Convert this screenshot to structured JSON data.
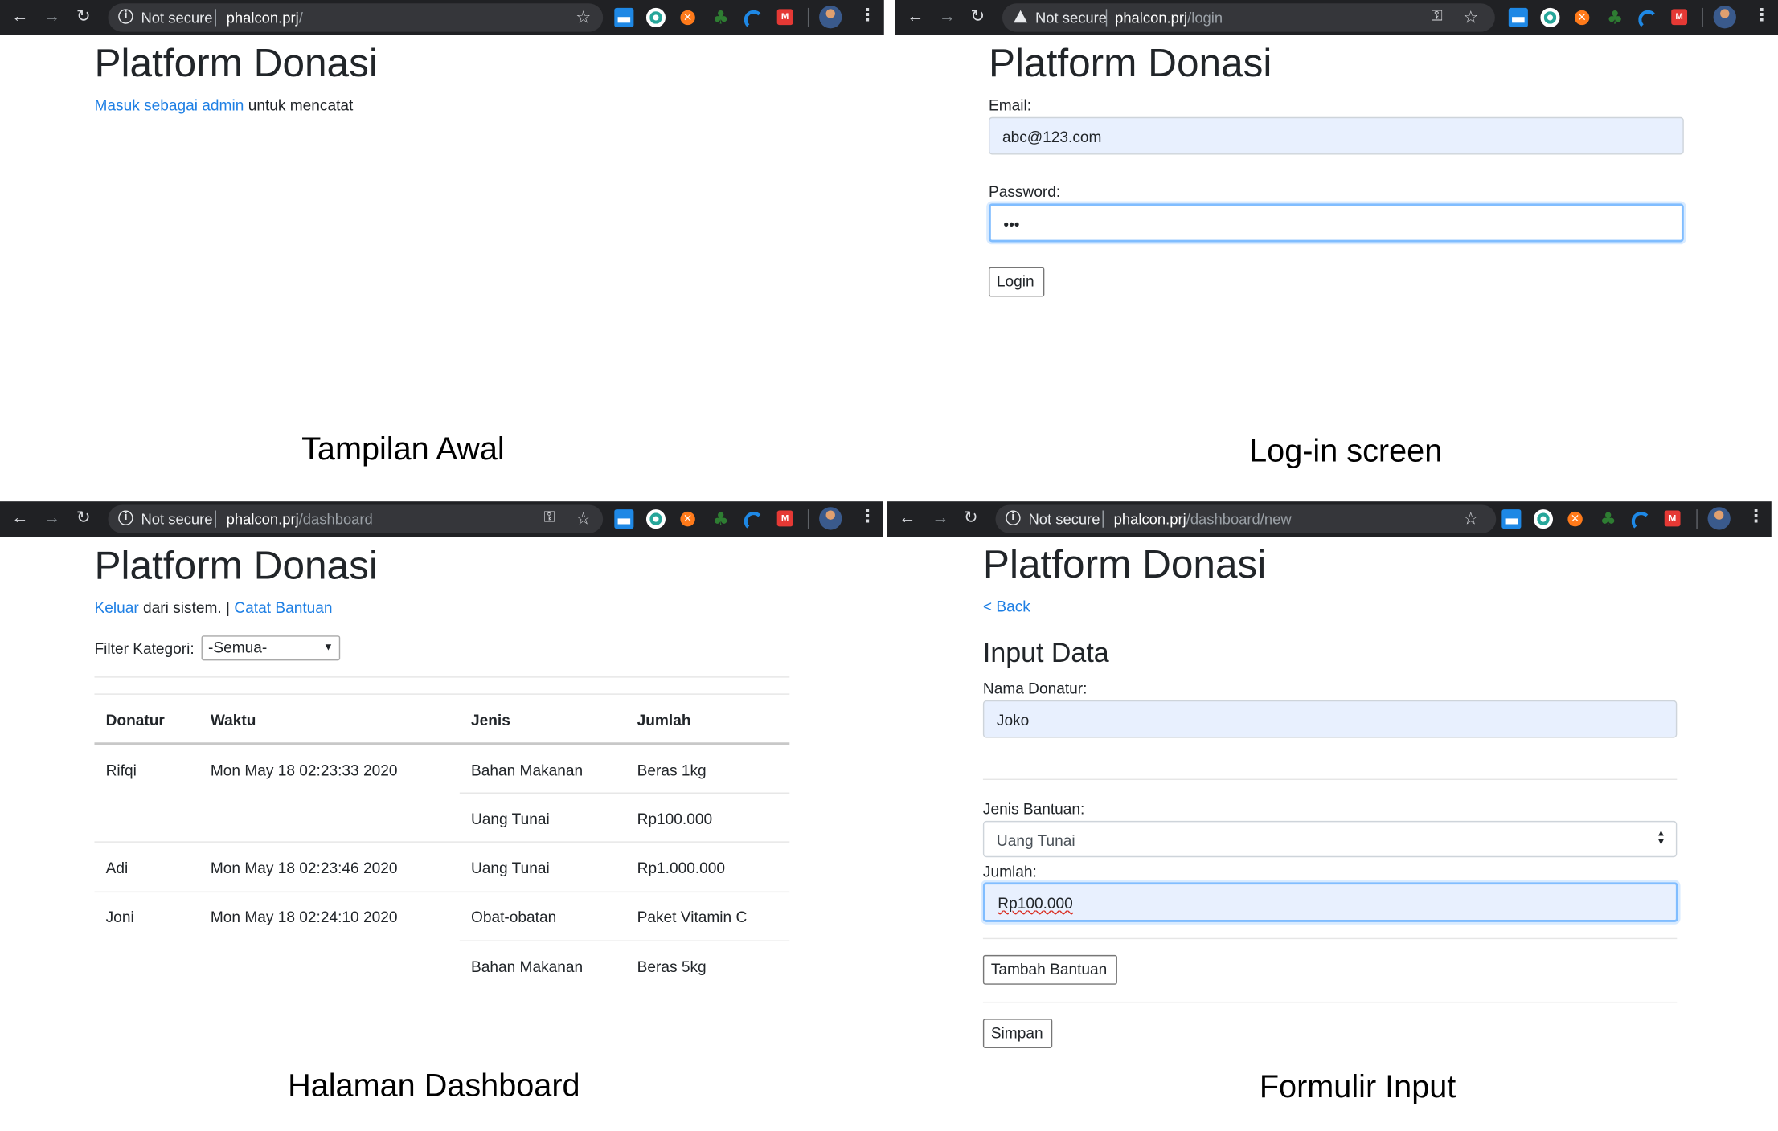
{
  "browser": {
    "not_secure": "Not secure",
    "host": "phalcon.prj",
    "pane1_path": "/",
    "pane2_path": "/login",
    "pane3_path": "/dashboard",
    "pane4_path": "/dashboard/new"
  },
  "app_title": "Platform Donasi",
  "home": {
    "login_link": "Masuk sebagai admin",
    "login_suffix": "untuk mencatat",
    "caption": "Tampilan Awal"
  },
  "login": {
    "email_label": "Email:",
    "email_value": "abc@123.com",
    "password_label": "Password:",
    "password_value": "•••",
    "login_button": "Login",
    "caption": "Log-in screen"
  },
  "dashboard": {
    "logout_link": "Keluar",
    "logout_suffix": "dari sistem. |",
    "record_link": "Catat Bantuan",
    "filter_label": "Filter Kategori:",
    "filter_value": "-Semua-",
    "columns": [
      "Donatur",
      "Waktu",
      "Jenis",
      "Jumlah"
    ],
    "rows": [
      {
        "donatur": "Rifqi",
        "waktu": "Mon May 18 02:23:33 2020",
        "items": [
          {
            "jenis": "Bahan Makanan",
            "jumlah": "Beras 1kg"
          },
          {
            "jenis": "Uang Tunai",
            "jumlah": "Rp100.000"
          }
        ]
      },
      {
        "donatur": "Adi",
        "waktu": "Mon May 18 02:23:46 2020",
        "items": [
          {
            "jenis": "Uang Tunai",
            "jumlah": "Rp1.000.000"
          }
        ]
      },
      {
        "donatur": "Joni",
        "waktu": "Mon May 18 02:24:10 2020",
        "items": [
          {
            "jenis": "Obat-obatan",
            "jumlah": "Paket Vitamin C"
          },
          {
            "jenis": "Bahan Makanan",
            "jumlah": "Beras 5kg"
          }
        ]
      }
    ],
    "caption": "Halaman Dashboard"
  },
  "form": {
    "back_link": "< Back",
    "heading": "Input Data",
    "name_label": "Nama Donatur:",
    "name_value": "Joko",
    "type_label": "Jenis Bantuan:",
    "type_value": "Uang Tunai",
    "amount_label": "Jumlah:",
    "amount_value": "Rp100.000",
    "add_button": "Tambah Bantuan",
    "save_button": "Simpan",
    "caption": "Formulir Input"
  },
  "icons": [
    "back-arrow-icon",
    "forward-arrow-icon",
    "reload-icon",
    "info-icon",
    "warning-icon",
    "key-icon",
    "star-icon",
    "kebab-menu-icon"
  ]
}
